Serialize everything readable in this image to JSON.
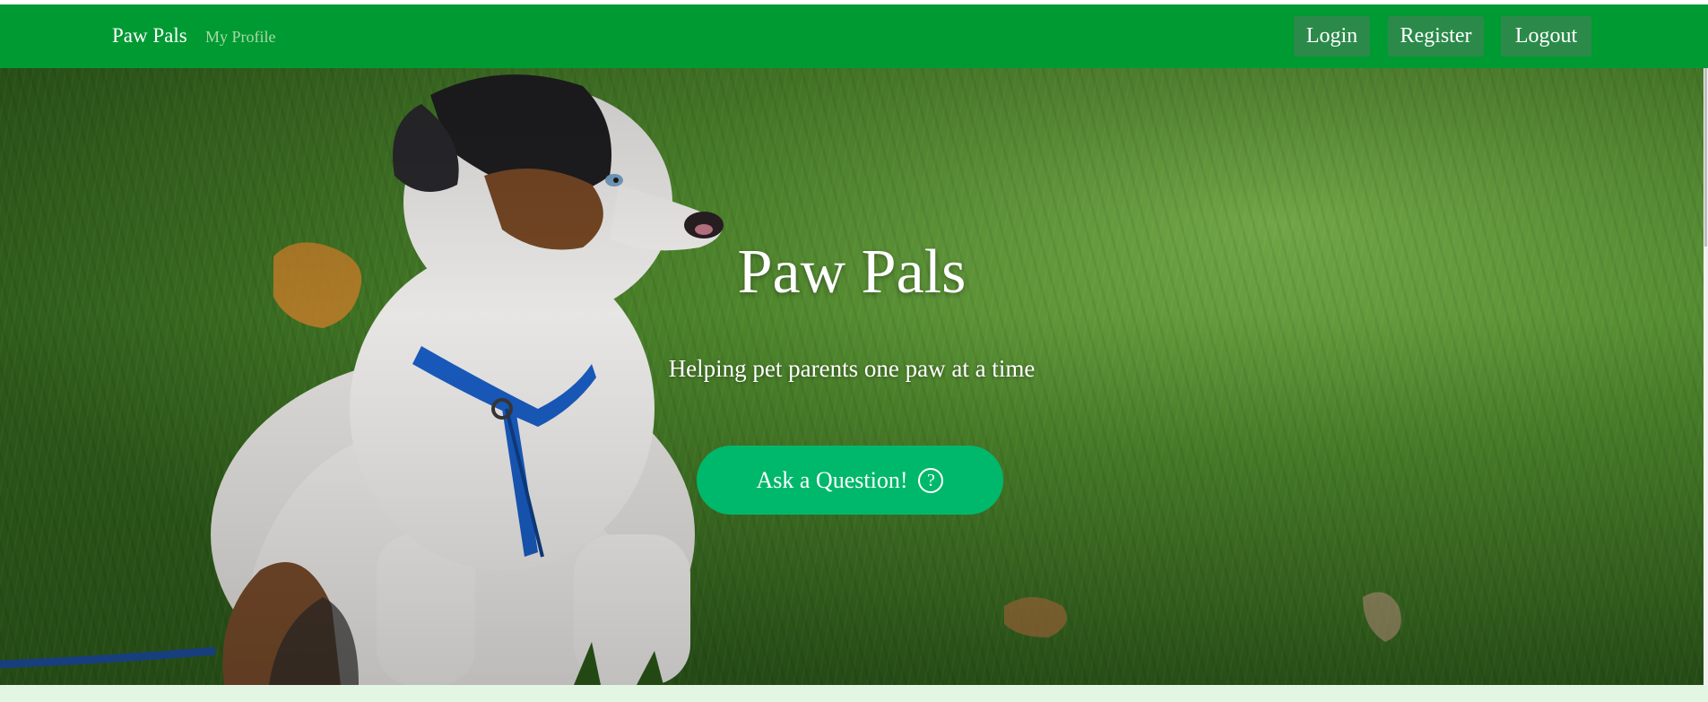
{
  "nav": {
    "brand": "Paw Pals",
    "profile_link": "My Profile",
    "buttons": {
      "login": "Login",
      "register": "Register",
      "logout": "Logout"
    }
  },
  "hero": {
    "title": "Paw Pals",
    "subtitle": "Helping pet parents one paw at a time",
    "cta_label": "Ask a Question!",
    "cta_icon": "question-circle-icon",
    "cta_icon_glyph": "?"
  },
  "colors": {
    "navbar": "#009a32",
    "nav_button": "#2b8a4a",
    "cta": "#00b86b",
    "bottom_strip": "#e3f6e3"
  }
}
